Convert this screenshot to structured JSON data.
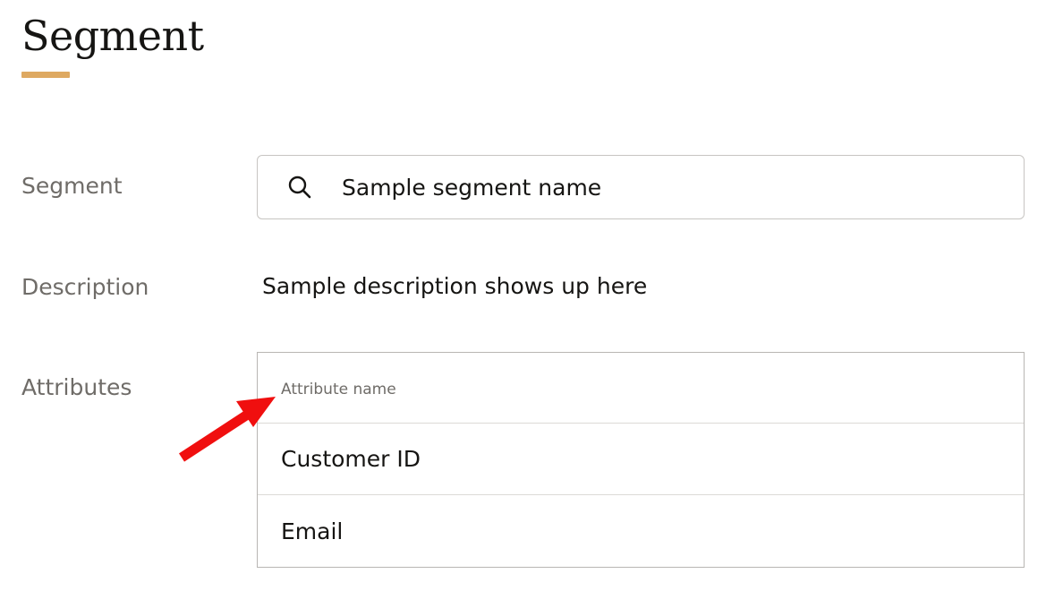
{
  "page": {
    "title": "Segment",
    "accent_color": "#dea961"
  },
  "form": {
    "segment": {
      "label": "Segment",
      "value": "Sample segment name",
      "icon": "search-icon"
    },
    "description": {
      "label": "Description",
      "value": "Sample description shows up here"
    },
    "attributes": {
      "label": "Attributes",
      "column_header": "Attribute name",
      "rows": [
        {
          "name": "Customer ID"
        },
        {
          "name": "Email"
        }
      ]
    }
  },
  "annotation": {
    "type": "arrow",
    "color": "#f00f0f",
    "points_to": "Attribute name"
  }
}
